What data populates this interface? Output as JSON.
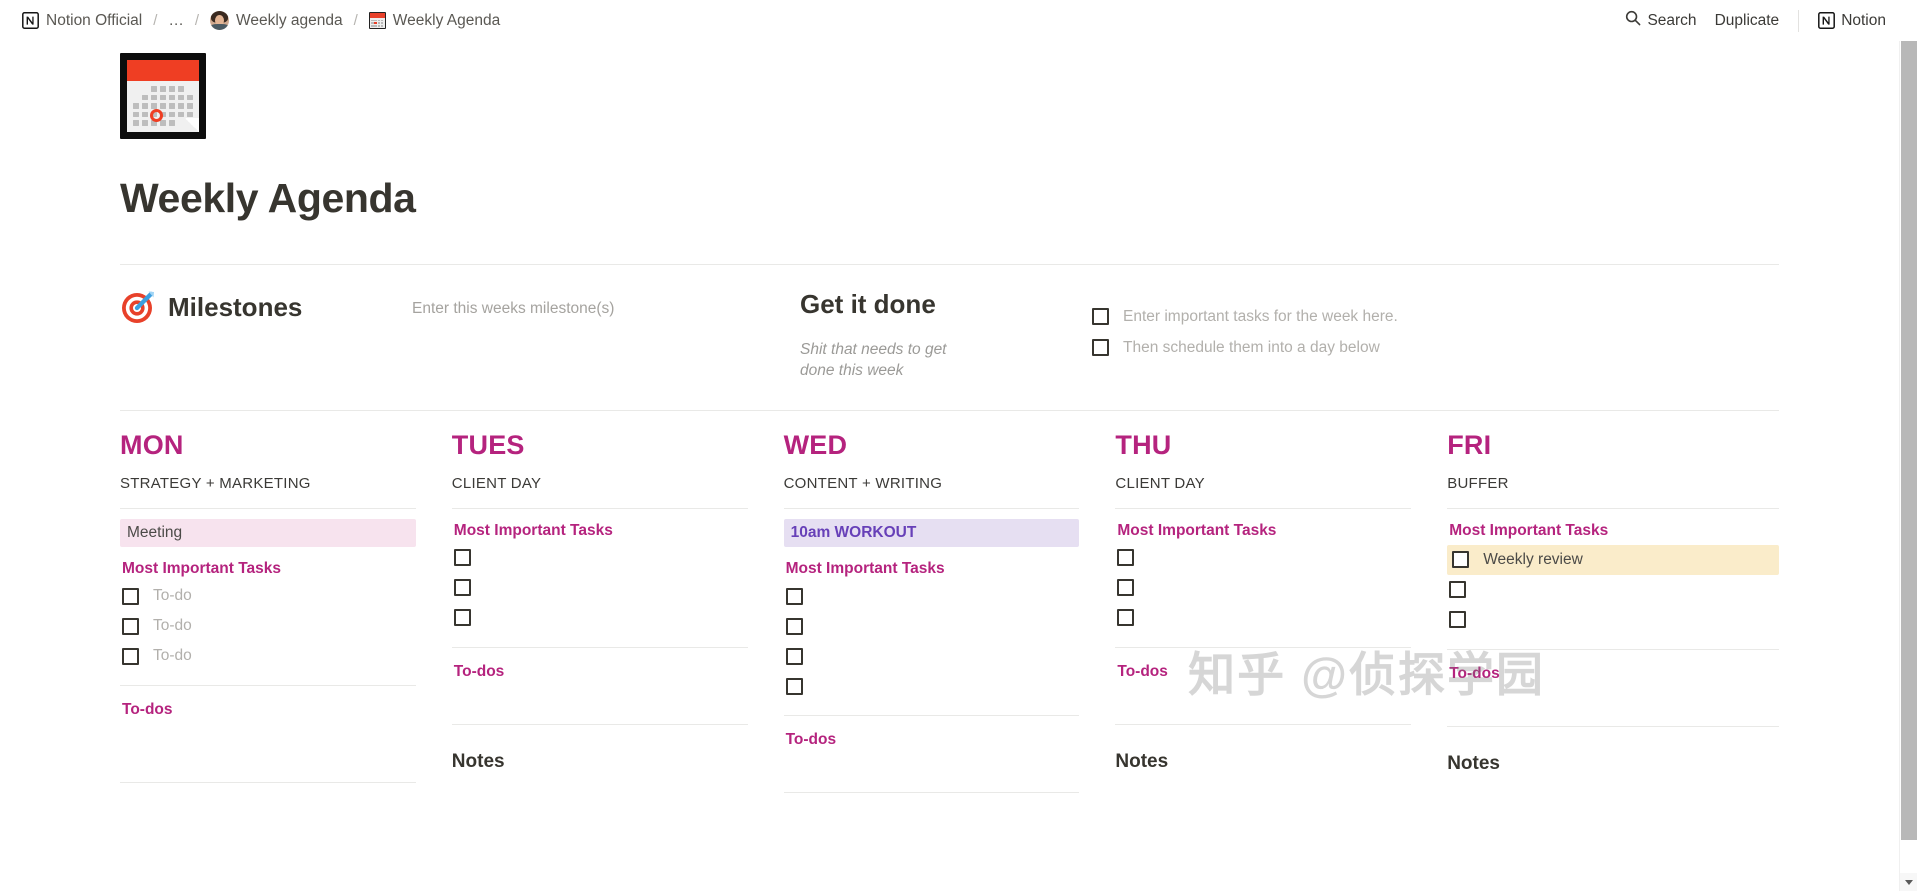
{
  "topbar": {
    "breadcrumbs": [
      {
        "label": "Notion Official",
        "icon": "notion-logo-icon"
      },
      {
        "label": "…",
        "icon": "none"
      },
      {
        "label": "Weekly agenda",
        "icon": "user-avatar-icon"
      },
      {
        "label": "Weekly Agenda",
        "icon": "calendar-icon"
      }
    ],
    "separator": "/",
    "search_label": "Search",
    "duplicate_label": "Duplicate",
    "notion_label": "Notion",
    "search_icon": "search-icon",
    "notion_icon": "notion-logo-icon"
  },
  "page": {
    "icon": "calendar-emoji",
    "title": "Weekly Agenda"
  },
  "milestones": {
    "emoji": "dart-target-icon",
    "title": "Milestones",
    "placeholder": "Enter this weeks milestone(s)"
  },
  "get_it_done": {
    "title": "Get it done",
    "subtitle": "Shit that needs to get done this week",
    "items": [
      {
        "label": "Enter important tasks for the week here.",
        "checked": false
      },
      {
        "label": "Then schedule them into a day below",
        "checked": false
      }
    ]
  },
  "labels": {
    "most_important_tasks": "Most Important Tasks",
    "todos": "To-dos",
    "notes": "Notes",
    "todo_placeholder": "To-do"
  },
  "colors": {
    "accent_magenta": "#b5237e",
    "purple_text": "#6740b8",
    "highlight_pink": "#f7e3ee",
    "highlight_purple": "#e6dff2",
    "highlight_cream": "#faecca",
    "text": "#37352f",
    "muted": "#9b9a97"
  },
  "days": [
    {
      "name": "MON",
      "focus": "STRATEGY + MARKETING",
      "highlight": {
        "text": "Meeting",
        "style": "pink"
      },
      "mit_label": "Most Important Tasks",
      "tasks": [
        {
          "text": "To-do",
          "placeholder": true,
          "checked": false,
          "highlight": "none"
        },
        {
          "text": "To-do",
          "placeholder": true,
          "checked": false,
          "highlight": "none"
        },
        {
          "text": "To-do",
          "placeholder": true,
          "checked": false,
          "highlight": "none"
        }
      ],
      "todos_label": "To-dos",
      "notes_label": ""
    },
    {
      "name": "TUES",
      "focus": "CLIENT DAY",
      "highlight": null,
      "mit_label": "Most Important Tasks",
      "tasks": [
        {
          "text": "",
          "placeholder": false,
          "checked": false,
          "highlight": "none"
        },
        {
          "text": "",
          "placeholder": false,
          "checked": false,
          "highlight": "none"
        },
        {
          "text": "",
          "placeholder": false,
          "checked": false,
          "highlight": "none"
        }
      ],
      "todos_label": "To-dos",
      "notes_label": "Notes"
    },
    {
      "name": "WED",
      "focus": "CONTENT + WRITING",
      "highlight": {
        "text": "10am WORKOUT",
        "style": "purple"
      },
      "mit_label": "Most Important Tasks",
      "tasks": [
        {
          "text": "",
          "placeholder": false,
          "checked": false,
          "highlight": "none"
        },
        {
          "text": "",
          "placeholder": false,
          "checked": false,
          "highlight": "none"
        },
        {
          "text": "",
          "placeholder": false,
          "checked": false,
          "highlight": "none"
        },
        {
          "text": "",
          "placeholder": false,
          "checked": false,
          "highlight": "none"
        }
      ],
      "todos_label": "To-dos",
      "notes_label": ""
    },
    {
      "name": "THU",
      "focus": "CLIENT DAY",
      "highlight": null,
      "mit_label": "Most Important Tasks",
      "tasks": [
        {
          "text": "",
          "placeholder": false,
          "checked": false,
          "highlight": "none"
        },
        {
          "text": "",
          "placeholder": false,
          "checked": false,
          "highlight": "none"
        },
        {
          "text": "",
          "placeholder": false,
          "checked": false,
          "highlight": "none"
        }
      ],
      "todos_label": "To-dos",
      "notes_label": "Notes"
    },
    {
      "name": "FRI",
      "focus": "BUFFER",
      "highlight": null,
      "mit_label": "Most Important Tasks",
      "tasks": [
        {
          "text": "Weekly review",
          "placeholder": false,
          "checked": false,
          "highlight": "cream"
        },
        {
          "text": "",
          "placeholder": false,
          "checked": false,
          "highlight": "none"
        },
        {
          "text": "",
          "placeholder": false,
          "checked": false,
          "highlight": "none"
        }
      ],
      "todos_label": "To-dos",
      "notes_label": "Notes"
    }
  ],
  "watermark": "知乎 @侦探学园",
  "scrollbar": {
    "up": "scroll-up-arrow",
    "down": "scroll-down-arrow"
  }
}
